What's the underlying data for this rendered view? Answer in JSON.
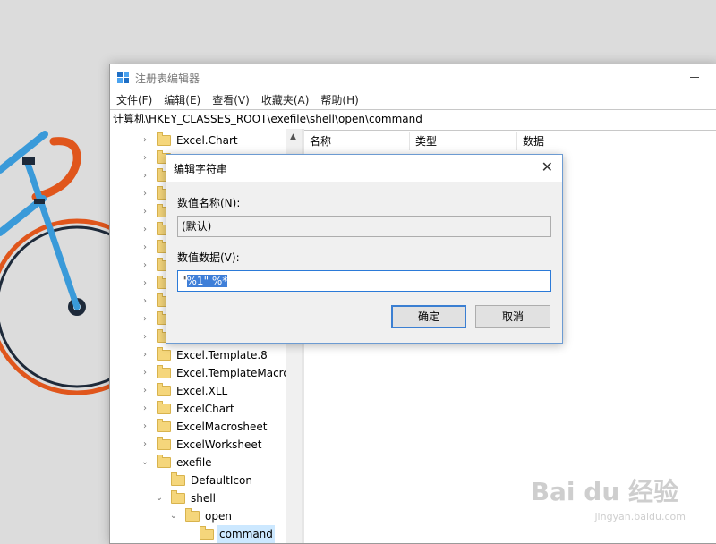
{
  "window": {
    "title": "注册表编辑器",
    "address": "计算机\\HKEY_CLASSES_ROOT\\exefile\\shell\\open\\command"
  },
  "menu": [
    "文件(F)",
    "编辑(E)",
    "查看(V)",
    "收藏夹(A)",
    "帮助(H)"
  ],
  "tree": [
    {
      "label": "Excel.Chart",
      "indent": 0,
      "expanded": false,
      "selected": false
    },
    {
      "label": "",
      "indent": 0,
      "expanded": false,
      "selected": false
    },
    {
      "label": "",
      "indent": 0,
      "expanded": false,
      "selected": false
    },
    {
      "label": "",
      "indent": 0,
      "expanded": false,
      "selected": false
    },
    {
      "label": "",
      "indent": 0,
      "expanded": false,
      "selected": false
    },
    {
      "label": "",
      "indent": 0,
      "expanded": false,
      "selected": false
    },
    {
      "label": "",
      "indent": 0,
      "expanded": false,
      "selected": false
    },
    {
      "label": "",
      "indent": 0,
      "expanded": false,
      "selected": false
    },
    {
      "label": "",
      "indent": 0,
      "expanded": false,
      "selected": false
    },
    {
      "label": "",
      "indent": 0,
      "expanded": false,
      "selected": false
    },
    {
      "label": "",
      "indent": 0,
      "expanded": false,
      "selected": false
    },
    {
      "label": "",
      "indent": 0,
      "expanded": false,
      "selected": false
    },
    {
      "label": "Excel.Template.8",
      "indent": 0,
      "expanded": false,
      "selected": false
    },
    {
      "label": "Excel.TemplateMacroE",
      "indent": 0,
      "expanded": false,
      "selected": false
    },
    {
      "label": "Excel.XLL",
      "indent": 0,
      "expanded": false,
      "selected": false
    },
    {
      "label": "ExcelChart",
      "indent": 0,
      "expanded": false,
      "selected": false
    },
    {
      "label": "ExcelMacrosheet",
      "indent": 0,
      "expanded": false,
      "selected": false
    },
    {
      "label": "ExcelWorksheet",
      "indent": 0,
      "expanded": false,
      "selected": false
    },
    {
      "label": "exefile",
      "indent": 0,
      "expanded": true,
      "selected": false
    },
    {
      "label": "DefaultIcon",
      "indent": 1,
      "expanded": null,
      "selected": false
    },
    {
      "label": "shell",
      "indent": 1,
      "expanded": true,
      "selected": false
    },
    {
      "label": "open",
      "indent": 2,
      "expanded": true,
      "selected": false
    },
    {
      "label": "command",
      "indent": 3,
      "expanded": null,
      "selected": true
    }
  ],
  "list": {
    "columns": [
      "名称",
      "类型",
      "数据"
    ]
  },
  "dialog": {
    "title": "编辑字符串",
    "close_glyph": "✕",
    "name_label": "数值名称(N):",
    "name_value": "(默认)",
    "data_label": "数值数据(V):",
    "data_prefix": "\"",
    "data_selected": "%1\" %*",
    "ok_label": "确定",
    "cancel_label": "取消"
  },
  "watermark": {
    "text": "Bai du 经验",
    "sub": "jingyan.baidu.com"
  },
  "colors": {
    "accent": "#3f7fd8",
    "tree_selected": "#cce8ff",
    "bike_blue": "#3a9ad9",
    "bike_orange": "#e0561c"
  }
}
